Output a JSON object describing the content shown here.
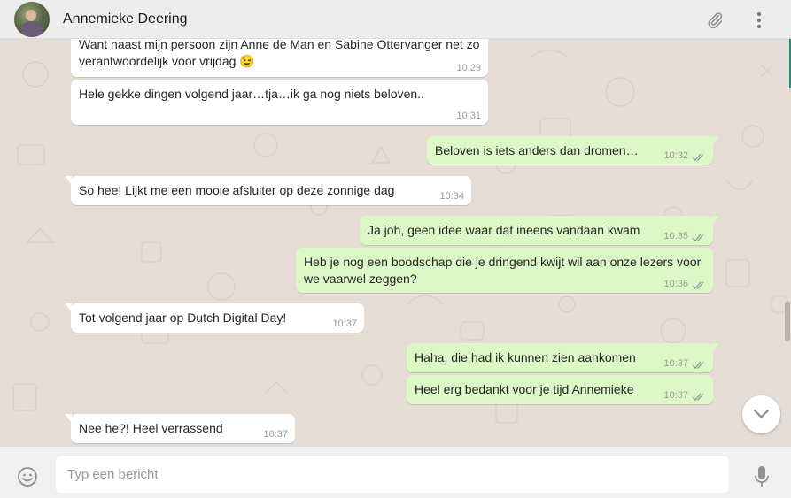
{
  "header": {
    "contact_name": "Annemieke Deering",
    "avatar_icon": "contact-avatar",
    "attach_icon": "paperclip-icon",
    "menu_icon": "kebab-menu-icon"
  },
  "colors": {
    "incoming_bubble": "#ffffff",
    "outgoing_bubble": "#dcf8c6",
    "chat_background": "#e5ddd5",
    "header_background": "#ededed",
    "read_ticks": "#4fc3f7",
    "time_text": "#9a9a9a"
  },
  "messages": [
    {
      "direction": "in",
      "text": "Want naast mijn persoon zijn Anne de Man en Sabine Ottervanger net zo verantwoordelijk voor vrijdag 😉",
      "time": "10:29"
    },
    {
      "direction": "in",
      "text": "Hele gekke dingen volgend jaar…tja…ik ga nog niets beloven..",
      "time": "10:31"
    },
    {
      "direction": "out",
      "text": "Beloven is iets anders dan dromen…",
      "time": "10:32"
    },
    {
      "direction": "in",
      "text": "So hee! Lijkt me een mooie afsluiter op deze zonnige dag",
      "time": "10:34"
    },
    {
      "direction": "out",
      "text": "Ja joh, geen idee waar dat ineens vandaan kwam",
      "time": "10:35"
    },
    {
      "direction": "out",
      "text": "Heb je nog een boodschap die je dringend kwijt wil aan onze lezers voor we vaarwel zeggen?",
      "time": "10:36"
    },
    {
      "direction": "in",
      "text": "Tot volgend jaar op Dutch Digital Day!",
      "time": "10:37"
    },
    {
      "direction": "out",
      "text": "Haha, die had ik kunnen zien aankomen",
      "time": "10:37"
    },
    {
      "direction": "out",
      "text": "Heel erg bedankt voor je tijd Annemieke",
      "time": "10:37"
    },
    {
      "direction": "in",
      "text": "Nee he?! Heel verrassend",
      "time": "10:37"
    }
  ],
  "composer": {
    "placeholder": "Typ een bericht",
    "emoji_icon": "smiley-icon",
    "mic_icon": "microphone-icon"
  },
  "scroll_down_icon": "chevron-down-icon"
}
